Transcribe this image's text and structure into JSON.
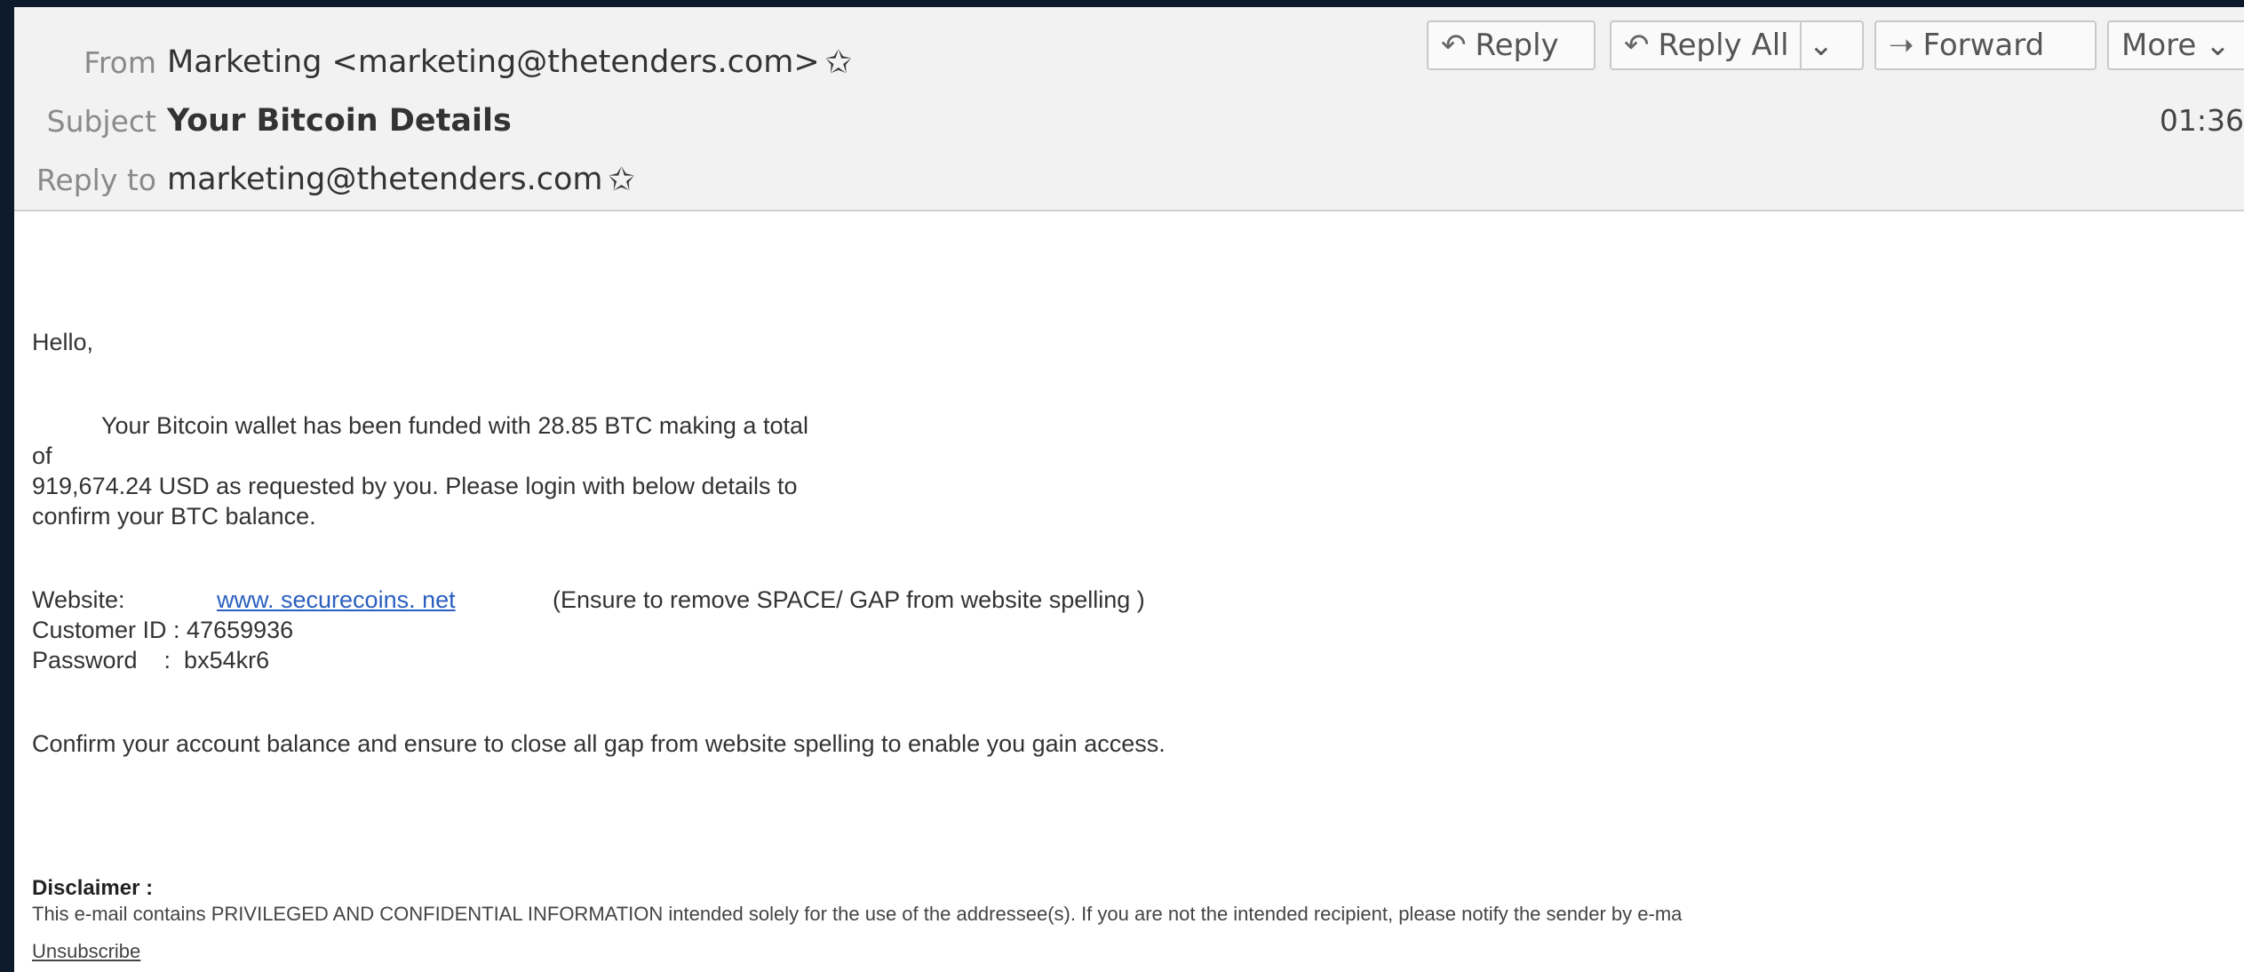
{
  "header": {
    "from_label": "From",
    "from_value": "Marketing <marketing@thetenders.com>",
    "subject_label": "Subject",
    "subject_value": "Your Bitcoin Details",
    "replyto_label": "Reply to",
    "replyto_value": "marketing@thetenders.com",
    "time": "01:36",
    "star_glyph": "✩"
  },
  "toolbar": {
    "reply": "Reply",
    "reply_all": "Reply All",
    "forward": "Forward",
    "more": "More",
    "reply_icon": "↶",
    "forward_icon": "➝",
    "chevron": "⌄"
  },
  "message": {
    "greeting": "Hello,",
    "line1": "Your Bitcoin wallet has been funded with 28.85 BTC making a total",
    "line2": "of",
    "line3": "919,674.24 USD as requested by you. Please login with below details to",
    "line4": "confirm your BTC balance.",
    "website_label": "Website:",
    "website_link": "www. securecoins. net",
    "website_note": "(Ensure to remove SPACE/ GAP from website spelling )",
    "customer_id": "Customer ID : 47659936",
    "password": "Password    :  bx54kr6",
    "confirm": "Confirm your account balance and ensure to close all gap from website spelling to enable you gain access.",
    "disclaimer_title": "Disclaimer :",
    "disclaimer_text": "This e-mail contains PRIVILEGED AND CONFIDENTIAL INFORMATION intended solely for the use of the addressee(s). If you are not the intended recipient, please notify the sender by e-ma",
    "unsubscribe": "Unsubscribe"
  }
}
